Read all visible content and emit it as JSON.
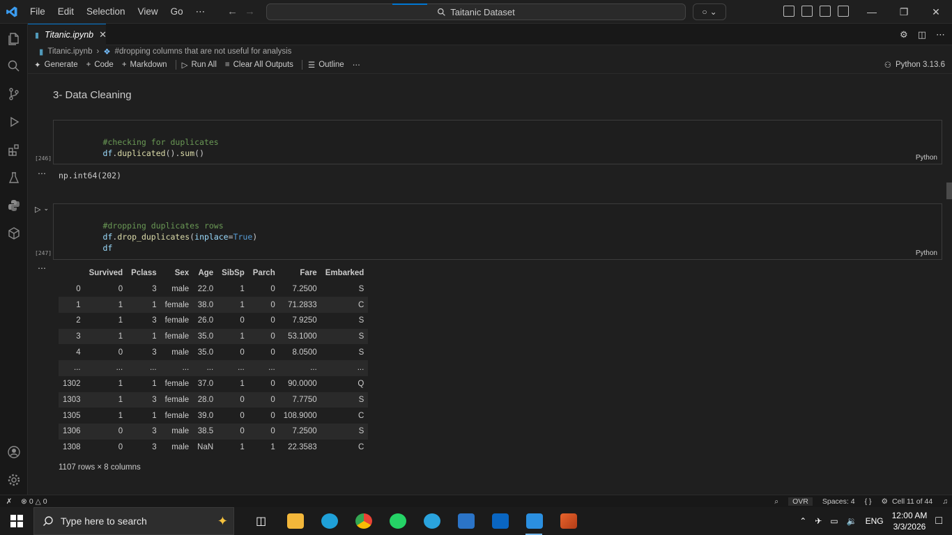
{
  "titlebar": {
    "menu": [
      "File",
      "Edit",
      "Selection",
      "View",
      "Go",
      "⋯"
    ],
    "search": "Taitanic Dataset"
  },
  "tab": {
    "filename": "Titanic.ipynb"
  },
  "breadcrumb": {
    "file": "Titanic.ipynb",
    "section": "#dropping columns that are not useful for analysis"
  },
  "toolbar": {
    "generate": "Generate",
    "code": "Code",
    "markdown": "Markdown",
    "run_all": "Run All",
    "clear_all": "Clear All Outputs",
    "outline": "Outline",
    "more": "⋯",
    "kernel": "Python 3.13.6"
  },
  "notebook": {
    "heading": "3- Data Cleaning",
    "cell1": {
      "count": "[246]",
      "line1": "#checking for duplicates",
      "line2": {
        "obj": "df",
        "dot1": ".",
        "fn1": "duplicated",
        "mid": "().",
        "fn2": "sum",
        "end": "()"
      },
      "language": "Python",
      "output": "np.int64(202)"
    },
    "cell2": {
      "count": "[247]",
      "line1": "#dropping duplicates rows",
      "line2": {
        "obj": "df",
        "dot": ".",
        "fn": "drop_duplicates",
        "open": "(",
        "arg": "inplace",
        "eq": "=",
        "val": "True",
        "close": ")"
      },
      "line3": "df",
      "language": "Python"
    },
    "output_dots": "⋯"
  },
  "dataframe": {
    "columns": [
      "",
      "Survived",
      "Pclass",
      "Sex",
      "Age",
      "SibSp",
      "Parch",
      "Fare",
      "Embarked"
    ],
    "rows": [
      [
        "0",
        "0",
        "3",
        "male",
        "22.0",
        "1",
        "0",
        "7.2500",
        "S"
      ],
      [
        "1",
        "1",
        "1",
        "female",
        "38.0",
        "1",
        "0",
        "71.2833",
        "C"
      ],
      [
        "2",
        "1",
        "3",
        "female",
        "26.0",
        "0",
        "0",
        "7.9250",
        "S"
      ],
      [
        "3",
        "1",
        "1",
        "female",
        "35.0",
        "1",
        "0",
        "53.1000",
        "S"
      ],
      [
        "4",
        "0",
        "3",
        "male",
        "35.0",
        "0",
        "0",
        "8.0500",
        "S"
      ],
      [
        "...",
        "...",
        "...",
        "...",
        "...",
        "...",
        "...",
        "...",
        "..."
      ],
      [
        "1302",
        "1",
        "1",
        "female",
        "37.0",
        "1",
        "0",
        "90.0000",
        "Q"
      ],
      [
        "1303",
        "1",
        "3",
        "female",
        "28.0",
        "0",
        "0",
        "7.7750",
        "S"
      ],
      [
        "1305",
        "1",
        "1",
        "female",
        "39.0",
        "0",
        "0",
        "108.9000",
        "C"
      ],
      [
        "1306",
        "0",
        "3",
        "male",
        "38.5",
        "0",
        "0",
        "7.2500",
        "S"
      ],
      [
        "1308",
        "0",
        "3",
        "male",
        "NaN",
        "1",
        "1",
        "22.3583",
        "C"
      ]
    ],
    "shape": "1107 rows × 8 columns"
  },
  "statusbar": {
    "errors": "0",
    "warnings": "0",
    "ovr": "OVR",
    "spaces": "Spaces: 4",
    "braces": "{ }",
    "cell": "Cell 11 of 44"
  },
  "taskbar": {
    "search_placeholder": "Type here to search",
    "lang": "ENG",
    "time": "12:00 AM",
    "date": "3/3/2026"
  },
  "colors": {
    "accent": "#0078d4",
    "comment": "#6a9955",
    "function": "#dcdcaa",
    "identifier": "#9cdcfe",
    "keyword": "#569cd6"
  }
}
